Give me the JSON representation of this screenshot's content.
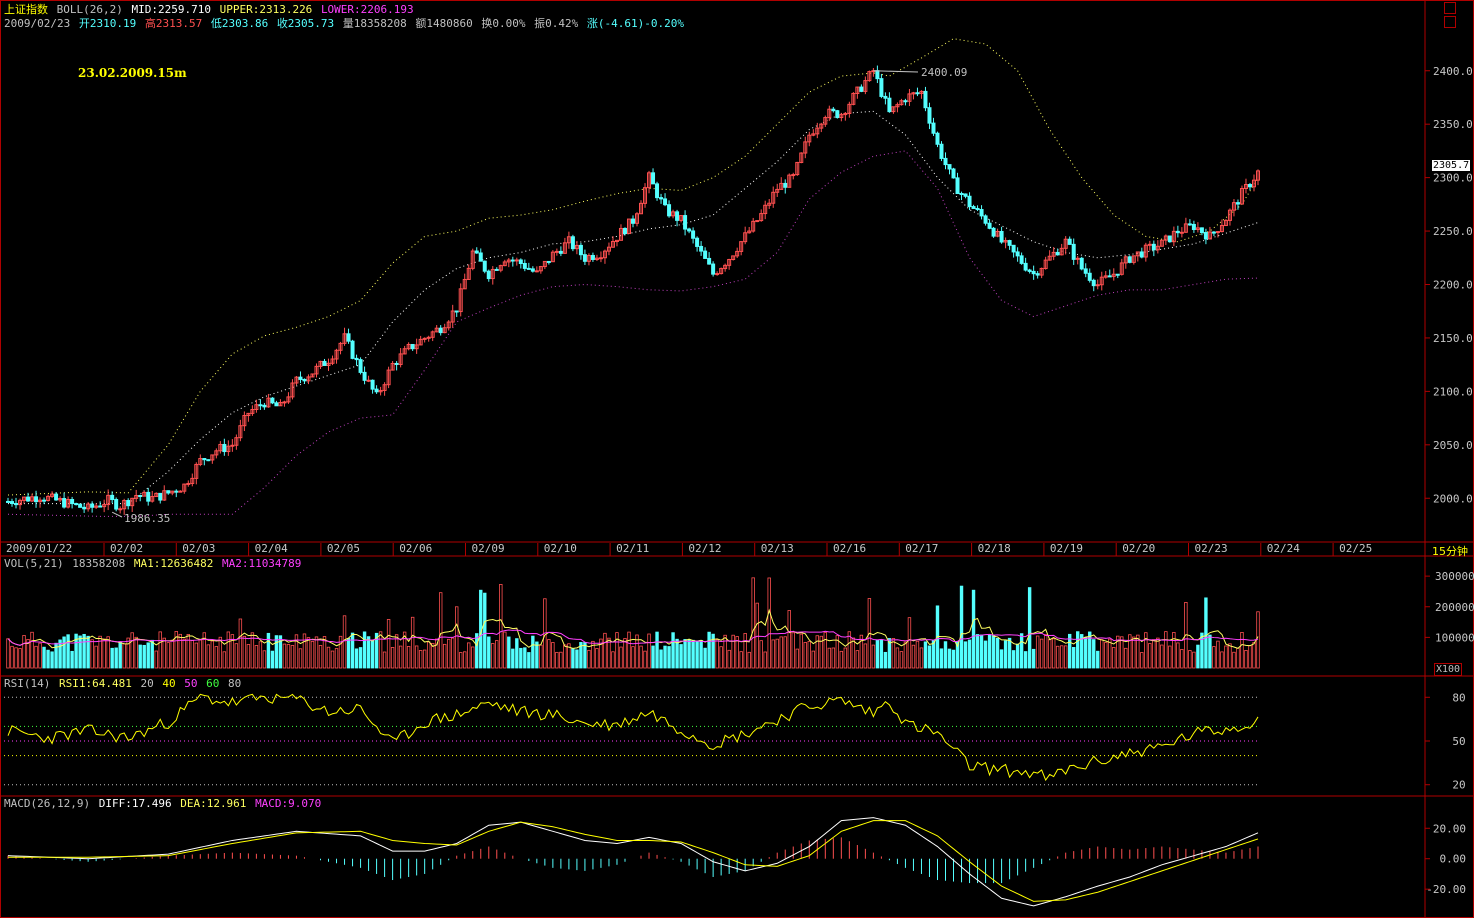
{
  "header": {
    "index_name": "上证指数",
    "boll_label": "BOLL(26,2)",
    "mid": "MID:2259.710",
    "upper": "UPPER:2313.226",
    "lower": "LOWER:2206.193",
    "date": "2009/02/23",
    "open": "开2310.19",
    "high": "高2313.57",
    "low": "低2303.86",
    "close": "收2305.73",
    "volume": "量18358208",
    "amount": "额1480860",
    "turnover": "换0.00%",
    "amplitude": "振0.42%",
    "change": "涨(-4.61)-0.20%"
  },
  "annotation": "23.02.2009.15m",
  "price_marks": {
    "high_label": "2400.09",
    "low_label": "1986.35",
    "last_price": "2305.7"
  },
  "period_label": "15分钟",
  "vol_header": {
    "name": "VOL(5,21)",
    "value": "18358208",
    "ma1": "MA1:12636482",
    "ma2": "MA2:11034789"
  },
  "vol_unit": "X100",
  "rsi_header": {
    "name": "RSI(14)",
    "rsi1": "RSI1:64.481",
    "l20": "20",
    "l40": "40",
    "l50": "50",
    "l60": "60",
    "l80": "80"
  },
  "macd_header": {
    "name": "MACD(26,12,9)",
    "diff": "DIFF:17.496",
    "dea": "DEA:12.961",
    "macd": "MACD:9.070"
  },
  "colors": {
    "up": "#ff5050",
    "down": "#54ffff",
    "frame": "#b00000",
    "upper": "#ffff60",
    "mid": "#ffffff",
    "lower": "#c040c0",
    "ma2": "#ff40ff",
    "diff": "#ffffff",
    "dea": "#ffff00"
  },
  "chart_data": {
    "type": "candlestick",
    "x_ticks": [
      "2009/01/22",
      "02/02",
      "02/03",
      "02/04",
      "02/05",
      "02/06",
      "02/09",
      "02/10",
      "02/11",
      "02/12",
      "02/13",
      "02/16",
      "02/17",
      "02/18",
      "02/19",
      "02/20",
      "02/23",
      "02/24",
      "02/25"
    ],
    "price_axis": {
      "ticks": [
        2000,
        2050,
        2100,
        2150,
        2200,
        2250,
        2300,
        2350,
        2400
      ],
      "labels": [
        "2000.0",
        "2050.0",
        "2100.0",
        "2150.0",
        "2200.0",
        "2250.0",
        "2300.0",
        "2350.0",
        "2400.0"
      ],
      "range": [
        1960,
        2440
      ]
    },
    "price_path": [
      [
        0,
        1997
      ],
      [
        8,
        2002
      ],
      [
        15,
        1995
      ],
      [
        20,
        1990
      ],
      [
        25,
        1998
      ],
      [
        28,
        1993
      ],
      [
        32,
        2003
      ],
      [
        36,
        2000
      ],
      [
        40,
        2005
      ],
      [
        44,
        2012
      ],
      [
        48,
        2035
      ],
      [
        52,
        2045
      ],
      [
        56,
        2050
      ],
      [
        60,
        2080
      ],
      [
        64,
        2090
      ],
      [
        68,
        2085
      ],
      [
        72,
        2110
      ],
      [
        76,
        2118
      ],
      [
        80,
        2130
      ],
      [
        84,
        2150
      ],
      [
        88,
        2120
      ],
      [
        92,
        2095
      ],
      [
        96,
        2125
      ],
      [
        100,
        2140
      ],
      [
        104,
        2150
      ],
      [
        108,
        2160
      ],
      [
        112,
        2178
      ],
      [
        116,
        2230
      ],
      [
        120,
        2210
      ],
      [
        124,
        2225
      ],
      [
        128,
        2220
      ],
      [
        132,
        2210
      ],
      [
        136,
        2228
      ],
      [
        140,
        2240
      ],
      [
        144,
        2225
      ],
      [
        148,
        2230
      ],
      [
        152,
        2245
      ],
      [
        156,
        2260
      ],
      [
        160,
        2300
      ],
      [
        164,
        2270
      ],
      [
        168,
        2260
      ],
      [
        172,
        2235
      ],
      [
        176,
        2210
      ],
      [
        180,
        2225
      ],
      [
        184,
        2245
      ],
      [
        188,
        2265
      ],
      [
        192,
        2290
      ],
      [
        196,
        2300
      ],
      [
        200,
        2340
      ],
      [
        204,
        2360
      ],
      [
        208,
        2360
      ],
      [
        212,
        2380
      ],
      [
        216,
        2400
      ],
      [
        220,
        2360
      ],
      [
        224,
        2375
      ],
      [
        228,
        2380
      ],
      [
        232,
        2330
      ],
      [
        236,
        2295
      ],
      [
        240,
        2275
      ],
      [
        244,
        2260
      ],
      [
        248,
        2240
      ],
      [
        252,
        2225
      ],
      [
        256,
        2210
      ],
      [
        260,
        2225
      ],
      [
        264,
        2240
      ],
      [
        268,
        2215
      ],
      [
        272,
        2200
      ],
      [
        276,
        2210
      ],
      [
        280,
        2225
      ],
      [
        284,
        2232
      ],
      [
        288,
        2238
      ],
      [
        292,
        2250
      ],
      [
        296,
        2255
      ],
      [
        300,
        2245
      ],
      [
        304,
        2262
      ],
      [
        308,
        2285
      ],
      [
        312,
        2305
      ]
    ],
    "upper_path": [
      [
        0,
        2003
      ],
      [
        20,
        2006
      ],
      [
        30,
        2005
      ],
      [
        40,
        2050
      ],
      [
        48,
        2100
      ],
      [
        56,
        2135
      ],
      [
        64,
        2152
      ],
      [
        72,
        2160
      ],
      [
        80,
        2170
      ],
      [
        88,
        2185
      ],
      [
        96,
        2220
      ],
      [
        104,
        2245
      ],
      [
        112,
        2250
      ],
      [
        120,
        2262
      ],
      [
        128,
        2265
      ],
      [
        136,
        2270
      ],
      [
        144,
        2278
      ],
      [
        152,
        2285
      ],
      [
        160,
        2290
      ],
      [
        168,
        2288
      ],
      [
        176,
        2300
      ],
      [
        184,
        2320
      ],
      [
        192,
        2350
      ],
      [
        200,
        2380
      ],
      [
        208,
        2395
      ],
      [
        216,
        2398
      ],
      [
        220,
        2395
      ],
      [
        228,
        2412
      ],
      [
        236,
        2430
      ],
      [
        244,
        2425
      ],
      [
        252,
        2400
      ],
      [
        260,
        2345
      ],
      [
        268,
        2300
      ],
      [
        276,
        2265
      ],
      [
        284,
        2245
      ],
      [
        292,
        2240
      ],
      [
        300,
        2250
      ],
      [
        308,
        2275
      ],
      [
        312,
        2300
      ]
    ],
    "mid_path": [
      [
        0,
        1995
      ],
      [
        20,
        1995
      ],
      [
        30,
        1995
      ],
      [
        40,
        2025
      ],
      [
        48,
        2055
      ],
      [
        56,
        2080
      ],
      [
        64,
        2095
      ],
      [
        72,
        2105
      ],
      [
        80,
        2115
      ],
      [
        88,
        2125
      ],
      [
        96,
        2165
      ],
      [
        104,
        2195
      ],
      [
        112,
        2215
      ],
      [
        120,
        2225
      ],
      [
        128,
        2230
      ],
      [
        136,
        2238
      ],
      [
        144,
        2240
      ],
      [
        152,
        2245
      ],
      [
        160,
        2252
      ],
      [
        168,
        2256
      ],
      [
        176,
        2265
      ],
      [
        184,
        2290
      ],
      [
        192,
        2315
      ],
      [
        200,
        2345
      ],
      [
        208,
        2360
      ],
      [
        216,
        2362
      ],
      [
        224,
        2340
      ],
      [
        232,
        2300
      ],
      [
        240,
        2270
      ],
      [
        248,
        2255
      ],
      [
        256,
        2240
      ],
      [
        264,
        2230
      ],
      [
        272,
        2225
      ],
      [
        280,
        2228
      ],
      [
        288,
        2233
      ],
      [
        296,
        2238
      ],
      [
        304,
        2248
      ],
      [
        312,
        2258
      ]
    ],
    "lower_path": [
      [
        0,
        1985
      ],
      [
        24,
        1983
      ],
      [
        32,
        1983
      ],
      [
        40,
        1985
      ],
      [
        48,
        1985
      ],
      [
        56,
        1985
      ],
      [
        64,
        2010
      ],
      [
        72,
        2040
      ],
      [
        80,
        2062
      ],
      [
        88,
        2075
      ],
      [
        96,
        2078
      ],
      [
        104,
        2120
      ],
      [
        112,
        2165
      ],
      [
        120,
        2178
      ],
      [
        128,
        2190
      ],
      [
        136,
        2198
      ],
      [
        144,
        2200
      ],
      [
        152,
        2198
      ],
      [
        160,
        2195
      ],
      [
        168,
        2194
      ],
      [
        176,
        2198
      ],
      [
        184,
        2205
      ],
      [
        192,
        2230
      ],
      [
        200,
        2280
      ],
      [
        208,
        2305
      ],
      [
        216,
        2320
      ],
      [
        224,
        2325
      ],
      [
        232,
        2290
      ],
      [
        240,
        2225
      ],
      [
        248,
        2185
      ],
      [
        256,
        2170
      ],
      [
        264,
        2180
      ],
      [
        272,
        2190
      ],
      [
        280,
        2195
      ],
      [
        288,
        2195
      ],
      [
        296,
        2200
      ],
      [
        304,
        2205
      ],
      [
        312,
        2206
      ]
    ],
    "vol_axis": {
      "labels": [
        "100000",
        "200000",
        "300000"
      ],
      "ticks": [
        100000,
        200000,
        300000
      ],
      "range": [
        0,
        320000
      ]
    },
    "rsi_axis": {
      "labels": [
        "20",
        "50",
        "80"
      ],
      "ticks": [
        20,
        50,
        80
      ],
      "range": [
        15,
        85
      ],
      "levels": [
        20,
        40,
        50,
        60,
        80
      ]
    },
    "rsi_path": [
      [
        0,
        57
      ],
      [
        10,
        52
      ],
      [
        20,
        57
      ],
      [
        30,
        52
      ],
      [
        40,
        63
      ],
      [
        48,
        80
      ],
      [
        56,
        76
      ],
      [
        64,
        80
      ],
      [
        72,
        79
      ],
      [
        80,
        70
      ],
      [
        88,
        72
      ],
      [
        96,
        48
      ],
      [
        104,
        63
      ],
      [
        112,
        68
      ],
      [
        120,
        76
      ],
      [
        128,
        70
      ],
      [
        136,
        68
      ],
      [
        144,
        62
      ],
      [
        152,
        61
      ],
      [
        160,
        70
      ],
      [
        168,
        58
      ],
      [
        176,
        48
      ],
      [
        184,
        55
      ],
      [
        192,
        65
      ],
      [
        200,
        74
      ],
      [
        208,
        78
      ],
      [
        216,
        69
      ],
      [
        220,
        78
      ],
      [
        224,
        62
      ],
      [
        232,
        55
      ],
      [
        240,
        33
      ],
      [
        248,
        30
      ],
      [
        256,
        28
      ],
      [
        260,
        24
      ],
      [
        264,
        30
      ],
      [
        272,
        36
      ],
      [
        280,
        42
      ],
      [
        288,
        46
      ],
      [
        296,
        55
      ],
      [
        304,
        58
      ],
      [
        312,
        64
      ]
    ],
    "macd_axis": {
      "labels": [
        "-20.00",
        "0.00",
        "20.00"
      ],
      "ticks": [
        -20,
        0,
        20
      ],
      "range": [
        -35,
        32
      ]
    },
    "diff_path": [
      [
        0,
        2
      ],
      [
        20,
        0
      ],
      [
        40,
        3
      ],
      [
        56,
        12
      ],
      [
        72,
        18
      ],
      [
        88,
        15
      ],
      [
        96,
        5
      ],
      [
        104,
        5
      ],
      [
        112,
        10
      ],
      [
        120,
        22
      ],
      [
        128,
        24
      ],
      [
        136,
        18
      ],
      [
        144,
        12
      ],
      [
        152,
        10
      ],
      [
        160,
        14
      ],
      [
        168,
        10
      ],
      [
        176,
        -2
      ],
      [
        184,
        -8
      ],
      [
        192,
        -3
      ],
      [
        200,
        8
      ],
      [
        208,
        25
      ],
      [
        216,
        27
      ],
      [
        224,
        22
      ],
      [
        232,
        8
      ],
      [
        240,
        -10
      ],
      [
        248,
        -26
      ],
      [
        256,
        -31
      ],
      [
        264,
        -25
      ],
      [
        272,
        -18
      ],
      [
        280,
        -12
      ],
      [
        288,
        -4
      ],
      [
        296,
        2
      ],
      [
        304,
        8
      ],
      [
        312,
        17
      ]
    ],
    "dea_path": [
      [
        0,
        1
      ],
      [
        20,
        1
      ],
      [
        40,
        2
      ],
      [
        56,
        10
      ],
      [
        72,
        17
      ],
      [
        88,
        18
      ],
      [
        96,
        12
      ],
      [
        104,
        10
      ],
      [
        112,
        9
      ],
      [
        120,
        18
      ],
      [
        128,
        24
      ],
      [
        136,
        21
      ],
      [
        144,
        16
      ],
      [
        152,
        12
      ],
      [
        160,
        12
      ],
      [
        168,
        11
      ],
      [
        176,
        4
      ],
      [
        184,
        -4
      ],
      [
        192,
        -5
      ],
      [
        200,
        2
      ],
      [
        208,
        18
      ],
      [
        216,
        25
      ],
      [
        224,
        25
      ],
      [
        232,
        15
      ],
      [
        240,
        -2
      ],
      [
        248,
        -18
      ],
      [
        256,
        -28
      ],
      [
        264,
        -27
      ],
      [
        272,
        -22
      ],
      [
        280,
        -15
      ],
      [
        288,
        -8
      ],
      [
        296,
        -1
      ],
      [
        304,
        6
      ],
      [
        312,
        13
      ]
    ]
  }
}
